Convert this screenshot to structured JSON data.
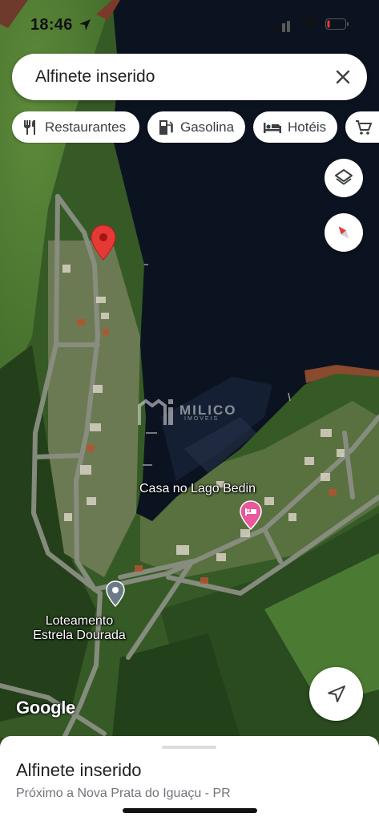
{
  "status_bar": {
    "time": "18:46"
  },
  "search": {
    "query": "Alfinete inserido"
  },
  "chips": [
    {
      "label": "Restaurantes",
      "icon": "fork-knife-icon"
    },
    {
      "label": "Gasolina",
      "icon": "gas-station-icon"
    },
    {
      "label": "Hotéis",
      "icon": "bed-icon"
    },
    {
      "label": "",
      "icon": "shopping-cart-icon"
    }
  ],
  "map": {
    "places": [
      {
        "name": "Casa no Lago Bedin"
      },
      {
        "name": "Loteamento Estrela Dourada"
      }
    ],
    "place_loteamento_line1": "Loteamento",
    "place_loteamento_line2": "Estrela Dourada",
    "watermark_brand": "MILICO",
    "watermark_sub": "IMÓVEIS",
    "attribution": "Google"
  },
  "sheet": {
    "title": "Alfinete inserido",
    "subtitle": "Próximo a Nova Prata do Iguaçu - PR"
  },
  "colors": {
    "pin_red": "#e53935",
    "hotel_pin": "#e8589a",
    "water": "#0d1422",
    "forest": "#2f4a22"
  }
}
